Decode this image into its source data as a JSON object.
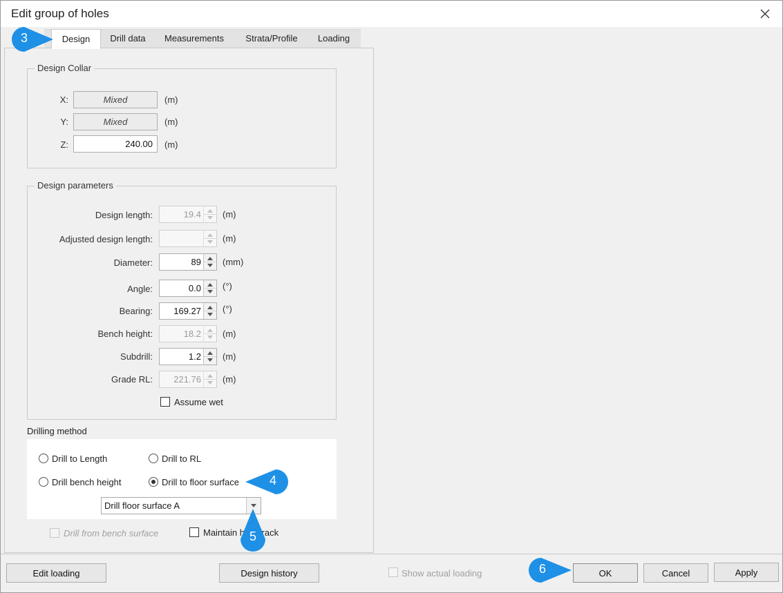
{
  "window": {
    "title": "Edit group of holes"
  },
  "tabs": [
    "Design",
    "Drill data",
    "Measurements",
    "Strata/Profile",
    "Loading"
  ],
  "design_collar": {
    "title": "Design Collar",
    "x": {
      "label": "X:",
      "value": "Mixed",
      "unit": "(m)"
    },
    "y": {
      "label": "Y:",
      "value": "Mixed",
      "unit": "(m)"
    },
    "z": {
      "label": "Z:",
      "value": "240.00",
      "unit": "(m)"
    }
  },
  "design_parameters": {
    "title": "Design parameters",
    "design_length": {
      "label": "Design length:",
      "value": "19.4",
      "unit": "(m)"
    },
    "adjusted_design_length": {
      "label": "Adjusted design length:",
      "value": "",
      "unit": "(m)"
    },
    "diameter": {
      "label": "Diameter:",
      "value": "89",
      "unit": "(mm)"
    },
    "angle": {
      "label": "Angle:",
      "value": "0.0",
      "unit": "(°)"
    },
    "bearing": {
      "label": "Bearing:",
      "value": "169.27",
      "unit": "(°)"
    },
    "bench_height": {
      "label": "Bench height:",
      "value": "18.2",
      "unit": "(m)"
    },
    "subdrill": {
      "label": "Subdrill:",
      "value": "1.2",
      "unit": "(m)"
    },
    "grade_rl": {
      "label": "Grade RL:",
      "value": "221.76",
      "unit": "(m)"
    },
    "assume_wet": "Assume wet"
  },
  "drilling_method": {
    "title": "Drilling method",
    "options": [
      "Drill to Length",
      "Drill to RL",
      "Drill bench height",
      "Drill to floor surface"
    ],
    "selected": "Drill to floor surface",
    "surface": "Drill floor surface A",
    "drill_from_bench_surface": "Drill from bench surface",
    "maintain_track": "Maintain hole track"
  },
  "buttons": {
    "edit_loading": "Edit loading",
    "design_history": "Design history",
    "show_actual_loading": "Show actual loading",
    "ok": "OK",
    "cancel": "Cancel",
    "apply": "Apply"
  },
  "callouts": [
    "3",
    "4",
    "5",
    "6"
  ],
  "colors": {
    "callout": "#1e90e6",
    "window_bg": "#f0f0f0"
  }
}
